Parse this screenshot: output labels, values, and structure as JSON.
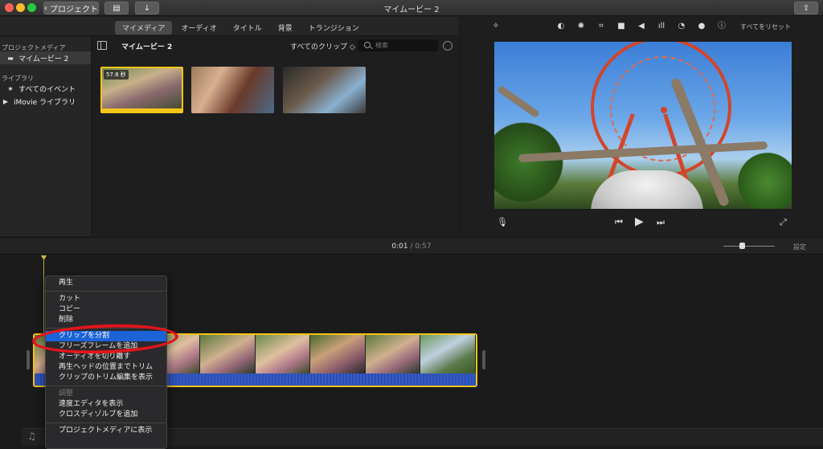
{
  "window": {
    "title": "マイムービー 2",
    "back_label": "プロジェクト"
  },
  "browser": {
    "tabs": [
      {
        "label": "マイメディア",
        "active": true
      },
      {
        "label": "オーディオ",
        "active": false
      },
      {
        "label": "タイトル",
        "active": false
      },
      {
        "label": "背景",
        "active": false
      },
      {
        "label": "トランジション",
        "active": false
      }
    ],
    "project_name": "マイムービー 2",
    "filter_label": "すべてのクリップ ◇",
    "search_placeholder": "検索",
    "clips": [
      {
        "duration": "57.8 秒",
        "selected": true
      },
      {
        "duration": "",
        "selected": false
      },
      {
        "duration": "",
        "selected": false
      }
    ]
  },
  "sidebar": {
    "section1": "プロジェクトメディア",
    "project_item": "マイムービー 2",
    "section2": "ライブラリ",
    "all_events": "すべてのイベント",
    "library": "iMovie ライブラリ"
  },
  "viewer": {
    "reset_label": "すべてをリセット"
  },
  "timeline": {
    "current_time": "0:01",
    "separator": " / ",
    "total_time": "0:57",
    "settings_label": "設定"
  },
  "context_menu": {
    "items": [
      {
        "label": "再生",
        "type": "item"
      },
      {
        "type": "separator"
      },
      {
        "label": "カット",
        "type": "item"
      },
      {
        "label": "コピー",
        "type": "item"
      },
      {
        "label": "削除",
        "type": "item"
      },
      {
        "type": "separator"
      },
      {
        "label": "クリップを分割",
        "type": "item",
        "highlight": true
      },
      {
        "label": "フリーズフレームを追加",
        "type": "item"
      },
      {
        "label": "オーディオを切り離す",
        "type": "item"
      },
      {
        "label": "再生ヘッドの位置までトリム",
        "type": "item"
      },
      {
        "label": "クリップのトリム編集を表示",
        "type": "item"
      },
      {
        "type": "separator"
      },
      {
        "label": "調整",
        "type": "item",
        "disabled": true
      },
      {
        "label": "速度エディタを表示",
        "type": "item"
      },
      {
        "label": "クロスディゾルブを追加",
        "type": "item"
      },
      {
        "type": "separator"
      },
      {
        "label": "プロジェクトメディアに表示",
        "type": "item"
      }
    ]
  },
  "colors": {
    "selection_yellow": "#f5c518",
    "menu_highlight": "#1c63d8",
    "annotation_red": "#e1141c"
  }
}
